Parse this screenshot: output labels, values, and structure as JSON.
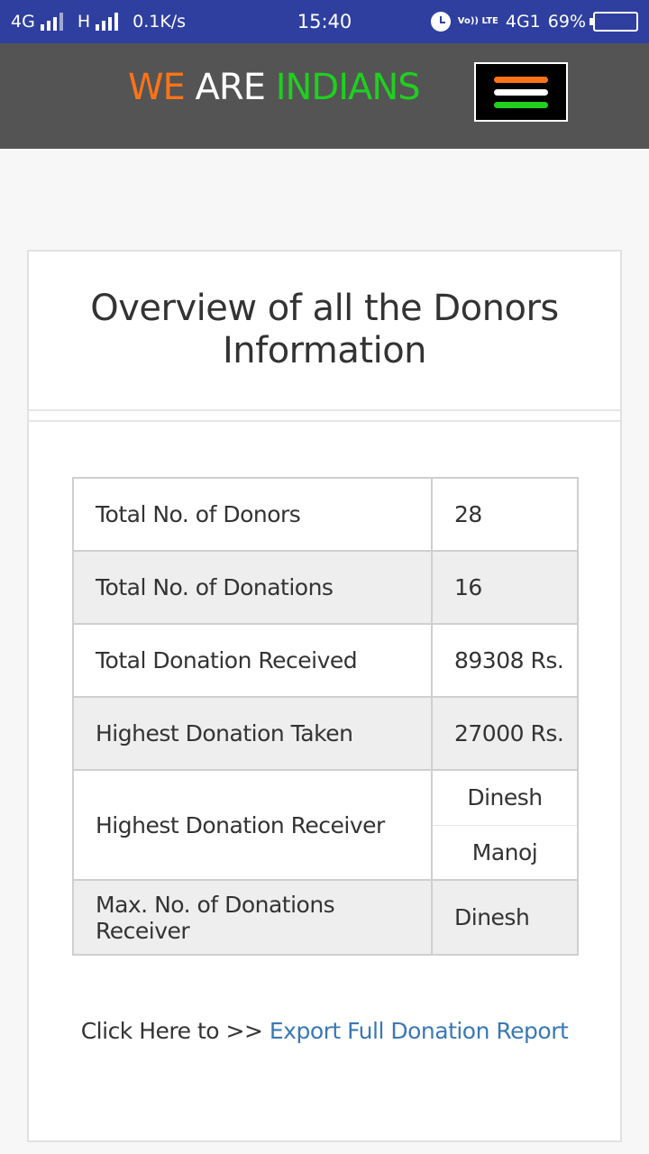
{
  "status_bar": {
    "network_left": "4G",
    "network_mid": "H",
    "speed": "0.1K/s",
    "time": "15:40",
    "volte": "Vo)) LTE",
    "network_right": "4G1",
    "battery": "69%",
    "battery_level": 0.69,
    "icons": [
      "signal-icon",
      "alarm-icon",
      "battery-icon"
    ]
  },
  "header": {
    "brand_word1": "WE",
    "brand_word2": "ARE",
    "brand_word3": "INDIANS",
    "colors": {
      "saffron": "#ff7318",
      "white": "#ffffff",
      "green": "#1fd01f",
      "background": "#545454"
    },
    "menu_icon": "hamburger-icon"
  },
  "card": {
    "title": "Overview of all the Donors Information",
    "rows": [
      {
        "label": "Total No. of Donors",
        "value": "28"
      },
      {
        "label": "Total No. of Donations",
        "value": "16"
      },
      {
        "label": "Total Donation Received",
        "value": "89308 Rs."
      },
      {
        "label": "Highest Donation Taken",
        "value": "27000 Rs."
      },
      {
        "label": "Highest Donation Receiver",
        "values": [
          "Dinesh",
          "Manoj"
        ]
      },
      {
        "label": "Max. No. of Donations Receiver",
        "value": "Dinesh"
      }
    ],
    "export_prefix": "Click Here to >>",
    "export_link": "Export Full Donation Report",
    "link_color": "#3a78b5"
  }
}
